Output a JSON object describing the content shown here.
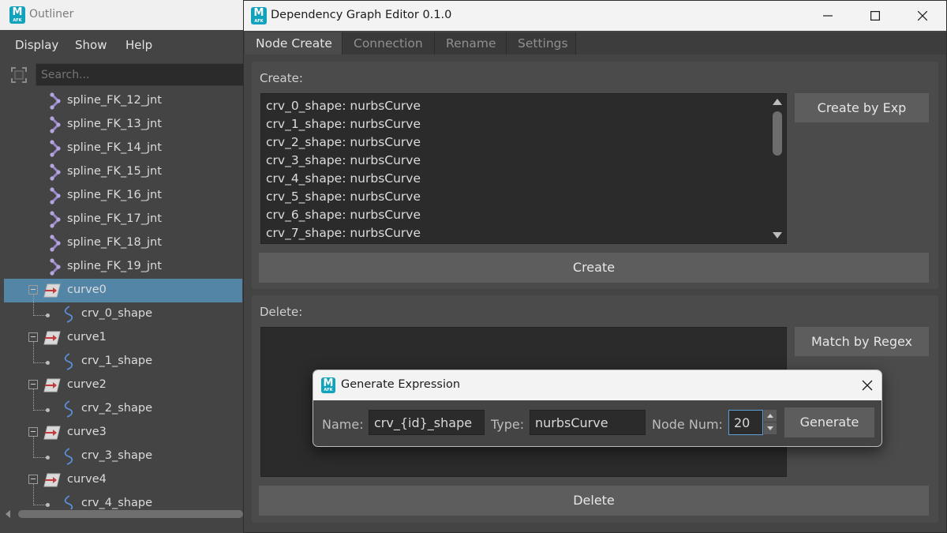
{
  "outliner": {
    "app_icon": {
      "letter": "M",
      "sub": "AFK",
      "color": "#11a2bd"
    },
    "title": "Outliner",
    "menu": [
      "Display",
      "Show",
      "Help"
    ],
    "search_placeholder": "Search...",
    "tree": [
      {
        "label": "spline_FK_12_jnt",
        "icon": "joint-icon",
        "level": "child",
        "selected": false
      },
      {
        "label": "spline_FK_13_jnt",
        "icon": "joint-icon",
        "level": "child",
        "selected": false
      },
      {
        "label": "spline_FK_14_jnt",
        "icon": "joint-icon",
        "level": "child",
        "selected": false
      },
      {
        "label": "spline_FK_15_jnt",
        "icon": "joint-icon",
        "level": "child",
        "selected": false
      },
      {
        "label": "spline_FK_16_jnt",
        "icon": "joint-icon",
        "level": "child",
        "selected": false
      },
      {
        "label": "spline_FK_17_jnt",
        "icon": "joint-icon",
        "level": "child",
        "selected": false
      },
      {
        "label": "spline_FK_18_jnt",
        "icon": "joint-icon",
        "level": "child",
        "selected": false
      },
      {
        "label": "spline_FK_19_jnt",
        "icon": "joint-icon",
        "level": "child",
        "selected": false
      },
      {
        "label": "curve0",
        "icon": "transform-icon",
        "level": "root",
        "selected": true
      },
      {
        "label": "crv_0_shape",
        "icon": "curve-shape-icon",
        "level": "shape",
        "selected": false
      },
      {
        "label": "curve1",
        "icon": "transform-icon",
        "level": "root",
        "selected": false
      },
      {
        "label": "crv_1_shape",
        "icon": "curve-shape-icon",
        "level": "shape",
        "selected": false
      },
      {
        "label": "curve2",
        "icon": "transform-icon",
        "level": "root",
        "selected": false
      },
      {
        "label": "crv_2_shape",
        "icon": "curve-shape-icon",
        "level": "shape",
        "selected": false
      },
      {
        "label": "curve3",
        "icon": "transform-icon",
        "level": "root",
        "selected": false
      },
      {
        "label": "crv_3_shape",
        "icon": "curve-shape-icon",
        "level": "shape",
        "selected": false
      },
      {
        "label": "curve4",
        "icon": "transform-icon",
        "level": "root",
        "selected": false
      },
      {
        "label": "crv_4_shape",
        "icon": "curve-shape-icon",
        "level": "shape",
        "selected": false
      }
    ]
  },
  "main": {
    "title": "Dependency Graph Editor 0.1.0",
    "tabs": [
      {
        "label": "Node Create",
        "active": true
      },
      {
        "label": "Connection",
        "active": false
      },
      {
        "label": "Rename",
        "active": false
      },
      {
        "label": "Settings",
        "active": false
      }
    ],
    "create": {
      "title": "Create:",
      "items": [
        "crv_0_shape: nurbsCurve",
        "crv_1_shape: nurbsCurve",
        "crv_2_shape: nurbsCurve",
        "crv_3_shape: nurbsCurve",
        "crv_4_shape: nurbsCurve",
        "crv_5_shape: nurbsCurve",
        "crv_6_shape: nurbsCurve",
        "crv_7_shape: nurbsCurve"
      ],
      "side_button": "Create by Exp",
      "action_button": "Create"
    },
    "delete": {
      "title": "Delete:",
      "side_button": "Match by Regex",
      "action_button": "Delete"
    }
  },
  "dialog": {
    "title": "Generate Expression",
    "name_label": "Name:",
    "name_value": "crv_{id}_shape",
    "type_label": "Type:",
    "type_value": "nurbsCurve",
    "num_label": "Node Num:",
    "num_value": "20",
    "generate_button": "Generate"
  }
}
